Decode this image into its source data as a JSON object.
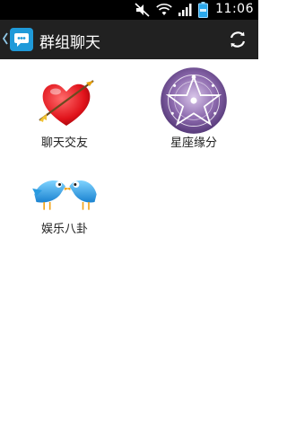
{
  "status_bar": {
    "time": "11:06",
    "icons": [
      "mute-icon",
      "wifi-icon",
      "signal-icon",
      "battery-icon"
    ]
  },
  "action_bar": {
    "title": "群组聊天",
    "left_icon": "back-caret-icon",
    "app_icon": "chat-app-icon",
    "right_icon": "refresh-icon"
  },
  "grid": {
    "items": [
      {
        "label": "聊天交友",
        "icon": "heart-arrow-icon"
      },
      {
        "label": "星座缘分",
        "icon": "zodiac-pentagram-icon"
      },
      {
        "label": "娱乐八卦",
        "icon": "kissing-birds-icon"
      }
    ]
  },
  "colors": {
    "status_bar_bg": "#000000",
    "action_bar_bg": "#212121",
    "accent": "#1f9ad9",
    "page_bg": "#ffffff"
  }
}
